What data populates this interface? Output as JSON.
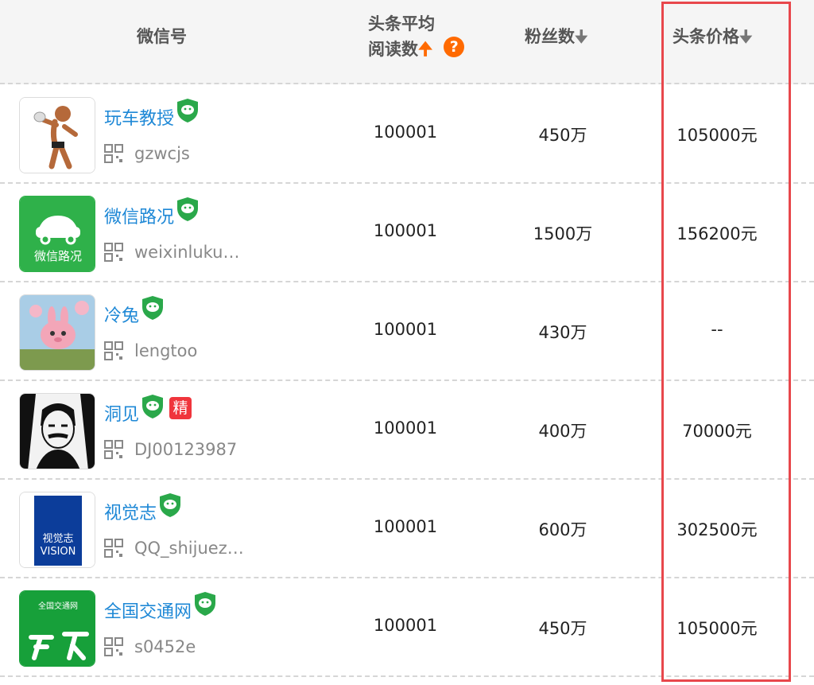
{
  "header": {
    "col_wechat": "微信号",
    "col_reads_line1": "头条平均",
    "col_reads_line2": "阅读数",
    "col_fans": "粉丝数",
    "col_price": "头条价格",
    "help_symbol": "?"
  },
  "rows": [
    {
      "name": "玩车教授",
      "account": "gzwcjs",
      "reads": "100001",
      "fans": "450万",
      "price": "105000元",
      "avatar_icon": "statue-avatar",
      "badge": ""
    },
    {
      "name": "微信路况",
      "account": "weixinluku…",
      "reads": "100001",
      "fans": "1500万",
      "price": "156200元",
      "avatar_icon": "car-avatar",
      "avatar_text": "微信路况",
      "badge": ""
    },
    {
      "name": "冷兔",
      "account": "lengtoo",
      "reads": "100001",
      "fans": "430万",
      "price": "--",
      "avatar_icon": "rabbit-avatar",
      "badge": ""
    },
    {
      "name": "洞见",
      "account": "DJ00123987",
      "reads": "100001",
      "fans": "400万",
      "price": "70000元",
      "avatar_icon": "portrait-avatar",
      "badge": "精"
    },
    {
      "name": "视觉志",
      "account": "QQ_shijuez…",
      "reads": "100001",
      "fans": "600万",
      "price": "302500元",
      "avatar_icon": "vision-avatar",
      "avatar_text": "视觉志",
      "avatar_text2": "VISION",
      "badge": ""
    },
    {
      "name": "全国交通网",
      "account": "s0452e",
      "reads": "100001",
      "fans": "450万",
      "price": "105000元",
      "avatar_icon": "transport-avatar",
      "avatar_text": "全国交通网",
      "badge": ""
    }
  ],
  "colors": {
    "link": "#1e88d6",
    "verify": "#2aa84a",
    "highlight": "#e8474c",
    "accent": "#ff6a00"
  }
}
